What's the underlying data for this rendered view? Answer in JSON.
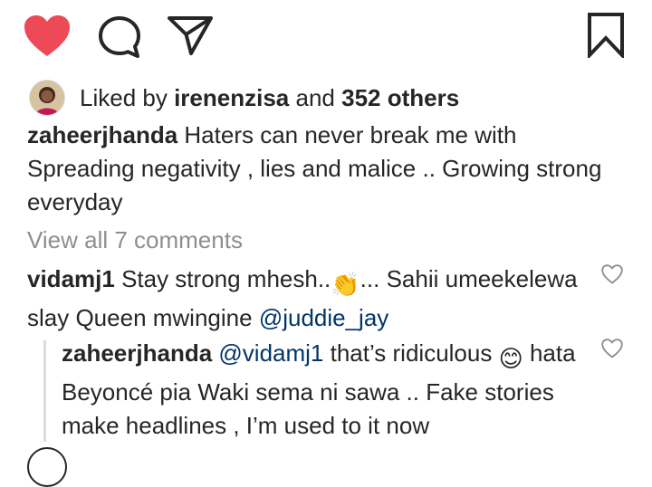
{
  "actions": {
    "like_icon": "heart-filled-icon",
    "comment_icon": "comment-icon",
    "share_icon": "share-icon",
    "save_icon": "bookmark-icon",
    "like_color": "#ed4956"
  },
  "likes": {
    "prefix": "Liked by",
    "user": "irenenzisa",
    "joiner": "and",
    "others": "352 others"
  },
  "caption": {
    "user": "zaheerjhanda",
    "text": "Haters can never break me with Spreading negativity , lies and malice .. Growing strong everyday"
  },
  "view_all": "View all 7 comments",
  "comment": {
    "user": "vidamj1",
    "text_before": "Stay strong mhesh..",
    "emoji": "👏",
    "text_after": "... Sahii umeekelewa slay Queen mwingine",
    "mention": "@juddie_jay"
  },
  "reply": {
    "user": "zaheerjhanda",
    "mention": "@vidamj1",
    "text_before": "that’s ridiculous",
    "emoji": "😊",
    "text_after": "hata Beyoncé pia Waki sema ni sawa .. Fake stories make headlines , I’m used to it now"
  },
  "colors": {
    "text": "#262626",
    "muted": "#8e8e8e",
    "mention": "#003569"
  }
}
